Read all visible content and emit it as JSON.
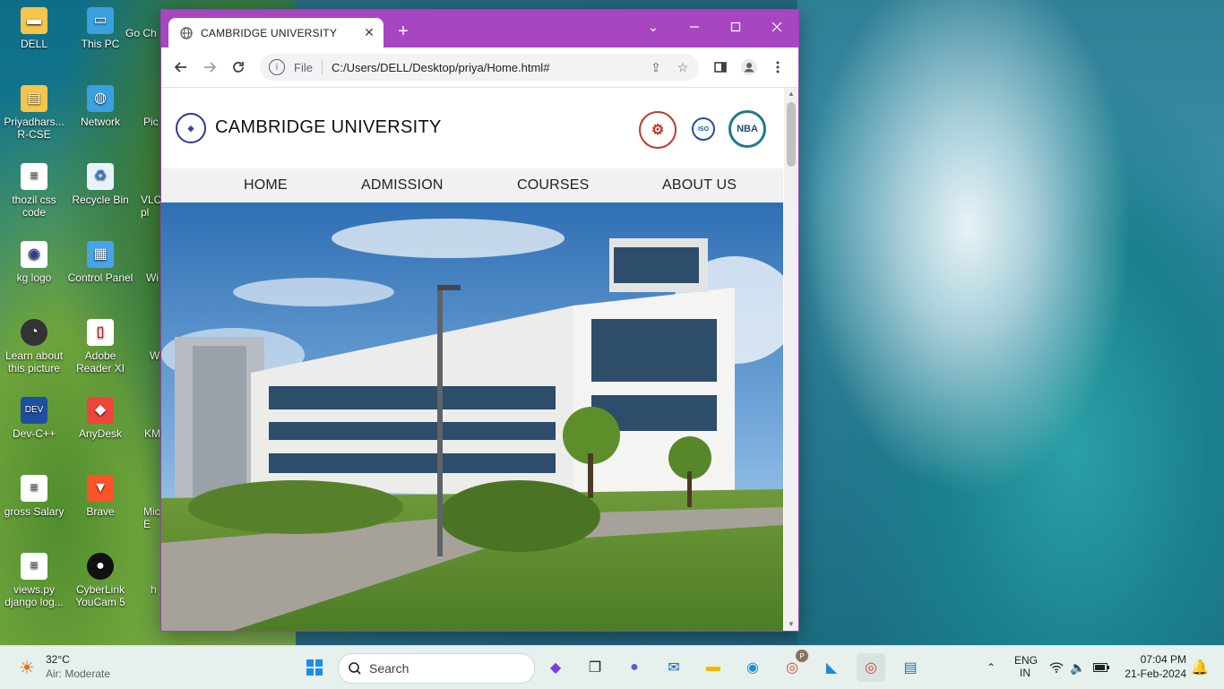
{
  "desktop": {
    "icons": [
      {
        "label": "DELL"
      },
      {
        "label": "This PC"
      },
      {
        "label": "Go Ch"
      },
      {
        "label": "Priyadhars... R-CSE"
      },
      {
        "label": "Network"
      },
      {
        "label": "Pic"
      },
      {
        "label": "thozil css code"
      },
      {
        "label": "Recycle Bin"
      },
      {
        "label": "VLC pl"
      },
      {
        "label": "kg logo"
      },
      {
        "label": "Control Panel"
      },
      {
        "label": "Wi"
      },
      {
        "label": "Learn about this picture"
      },
      {
        "label": "Adobe Reader XI"
      },
      {
        "label": "W"
      },
      {
        "label": "Dev-C++"
      },
      {
        "label": "AnyDesk"
      },
      {
        "label": "KM"
      },
      {
        "label": "gross Salary"
      },
      {
        "label": "Brave"
      },
      {
        "label": "Mic E"
      },
      {
        "label": "views.py django log..."
      },
      {
        "label": "CyberLink YouCam 5"
      },
      {
        "label": "h"
      }
    ]
  },
  "browser": {
    "tab_title": "CAMBRIDGE UNIVERSITY",
    "tab_close": "✕",
    "new_tab": "+",
    "address_scheme": "File",
    "address_url": "C:/Users/DELL/Desktop/priya/Home.html#"
  },
  "site": {
    "title": "CAMBRIDGE UNIVERSITY",
    "badges": {
      "iso": "ISO",
      "nba": "NBA"
    },
    "nav": [
      "HOME",
      "ADMISSION",
      "COURSES",
      "ABOUT US"
    ]
  },
  "taskbar": {
    "weather_temp": "32°C",
    "weather_desc": "Air: Moderate",
    "search_placeholder": "Search",
    "lang_top": "ENG",
    "lang_bottom": "IN",
    "time": "07:04 PM",
    "date": "21-Feb-2024",
    "profile_badge": "P"
  }
}
